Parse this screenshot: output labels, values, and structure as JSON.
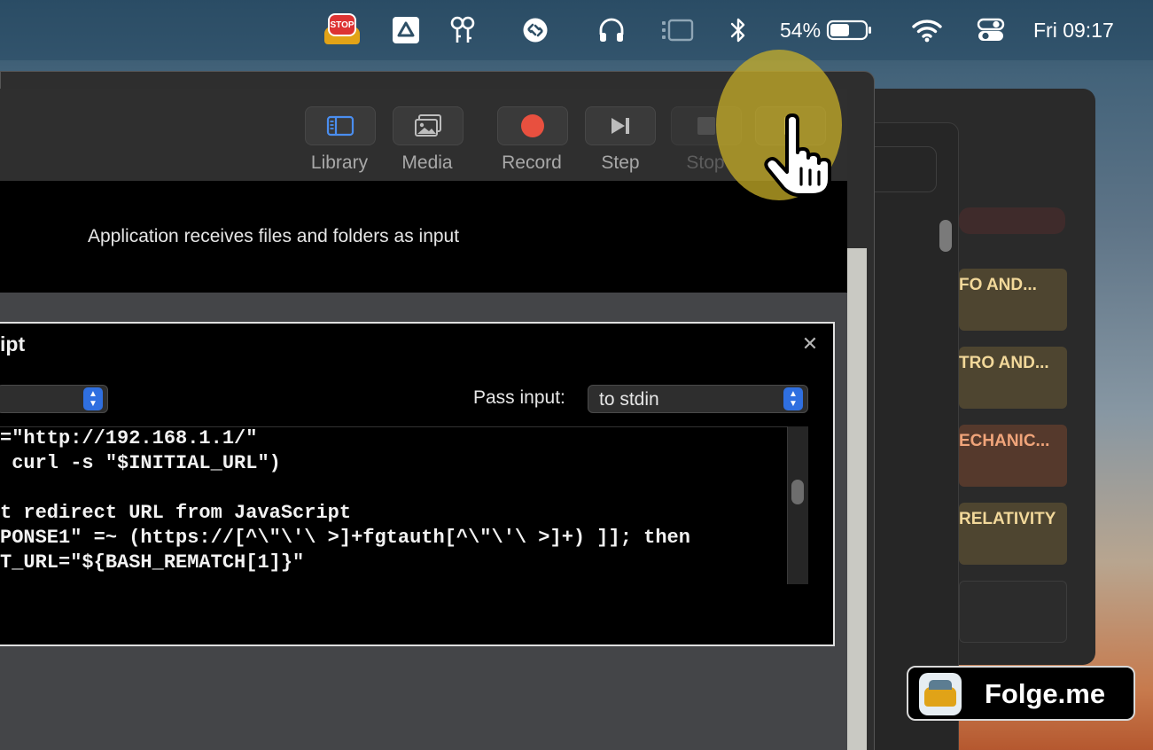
{
  "menubar": {
    "items": [
      {
        "icon": "stop-sign-car-icon"
      },
      {
        "icon": "google-drive-icon"
      },
      {
        "icon": "keys-icon"
      },
      {
        "icon": "shazam-icon"
      },
      {
        "icon": "headphones-icon"
      },
      {
        "icon": "stage-manager-icon"
      },
      {
        "icon": "bluetooth-icon"
      }
    ],
    "battery_percent": "54%",
    "battery_level": 0.54,
    "clock": "Fri 09:17"
  },
  "toolbar": {
    "library_label": "Library",
    "media_label": "Media",
    "record_label": "Record",
    "step_label": "Step",
    "stop_label": "Stop",
    "record_color": "#e8503f"
  },
  "workflow": {
    "input_description": "Application receives files and folders as input"
  },
  "action": {
    "title": "ipt",
    "pass_input_label": "Pass input:",
    "pass_input_value": "to stdin",
    "code_lines": [
      "=\"http://192.168.1.1/\"",
      " curl -s \"$INITIAL_URL\")",
      "",
      "t redirect URL from JavaScript",
      "PONSE1\" =~ (https://[^\\\"\\'\\ >]+fgtauth[^\\\"\\'\\ >]+) ]]; then",
      "T_URL=\"${BASH_REMATCH[1]}\""
    ]
  },
  "side_cards": [
    {
      "label": "FO AND..."
    },
    {
      "label": "TRO AND..."
    },
    {
      "label": "ECHANIC..."
    },
    {
      "label": "RELATIVITY"
    }
  ],
  "watermark": {
    "text": "Folge.me",
    "icon": "car-logo-icon"
  },
  "highlight": {
    "color": "#c8af28",
    "cursor": "hand-pointer-icon"
  }
}
